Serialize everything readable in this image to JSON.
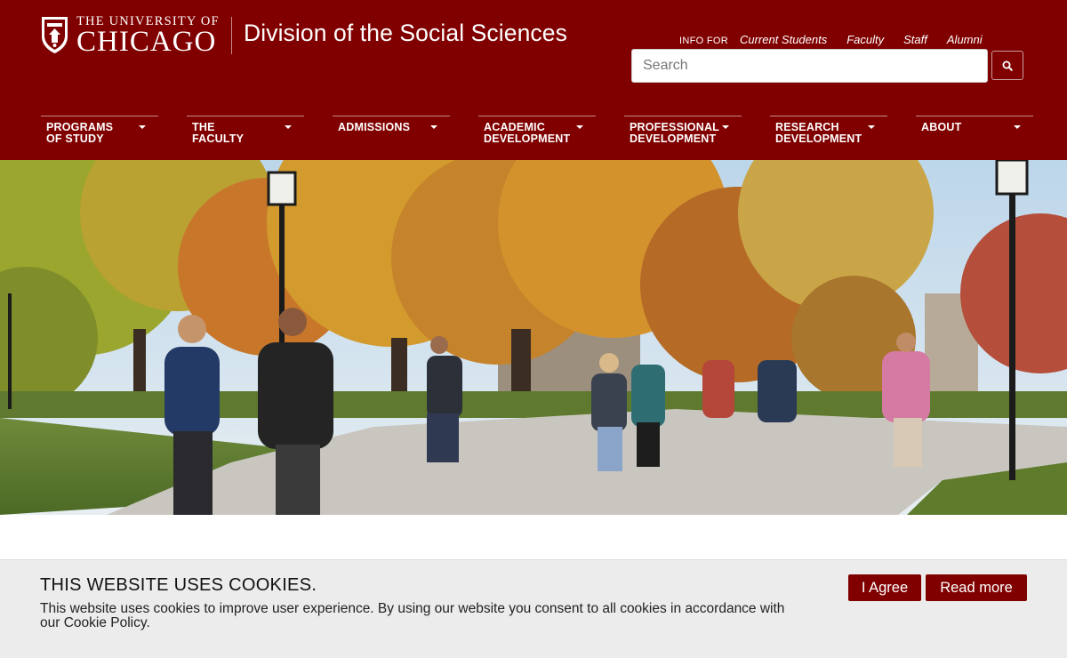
{
  "header": {
    "logo_top": "THE UNIVERSITY OF",
    "logo_bottom": "CHICAGO",
    "division_title": "Division of the Social Sciences",
    "info_for_label": "INFO FOR",
    "info_links": [
      "Current Students",
      "Faculty",
      "Staff",
      "Alumni"
    ],
    "search_placeholder": "Search",
    "search_value": "",
    "brand_color": "#800000"
  },
  "nav": {
    "items": [
      {
        "line1": "PROGRAMS",
        "line2": "OF STUDY"
      },
      {
        "line1": "THE",
        "line2": "FACULTY"
      },
      {
        "line1": "ADMISSIONS",
        "line2": ""
      },
      {
        "line1": "ACADEMIC",
        "line2": "DEVELOPMENT"
      },
      {
        "line1": "PROFESSIONAL",
        "line2": "DEVELOPMENT"
      },
      {
        "line1": "RESEARCH",
        "line2": "DEVELOPMENT"
      },
      {
        "line1": "ABOUT",
        "line2": ""
      }
    ]
  },
  "cookie": {
    "title": "THIS WEBSITE USES COOKIES.",
    "text": "This website uses cookies to improve user experience. By using our website you consent to all cookies in accordance with our Cookie Policy.",
    "agree_label": "I Agree",
    "read_more_label": "Read more"
  }
}
